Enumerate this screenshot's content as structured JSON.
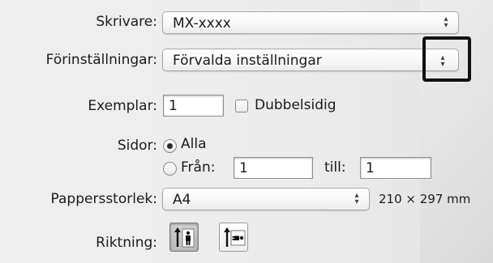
{
  "printer": {
    "label": "Skrivare:",
    "value": "MX-xxxx"
  },
  "presets": {
    "label": "Förinställningar:",
    "value": "Förvalda inställningar"
  },
  "copies": {
    "label": "Exemplar:",
    "value": "1",
    "duplex_label": "Dubbelsidig",
    "duplex_checked": false
  },
  "pages": {
    "label": "Sidor:",
    "all_label": "Alla",
    "from_label": "Från:",
    "from_value": "1",
    "to_label": "till:",
    "to_value": "1",
    "selected": "all"
  },
  "paper_size": {
    "label": "Pappersstorlek:",
    "value": "A4",
    "dimensions": "210 × 297 mm"
  },
  "orientation": {
    "label": "Riktning:",
    "options": [
      "portrait",
      "landscape"
    ],
    "selected": "portrait"
  },
  "icons": {
    "popup_arrows": "up-down-chevron-icon",
    "portrait": "portrait-orientation-icon",
    "landscape": "landscape-orientation-icon"
  },
  "colors": {
    "highlight_border": "#111111",
    "radio_dot": "#2b2b2b"
  }
}
